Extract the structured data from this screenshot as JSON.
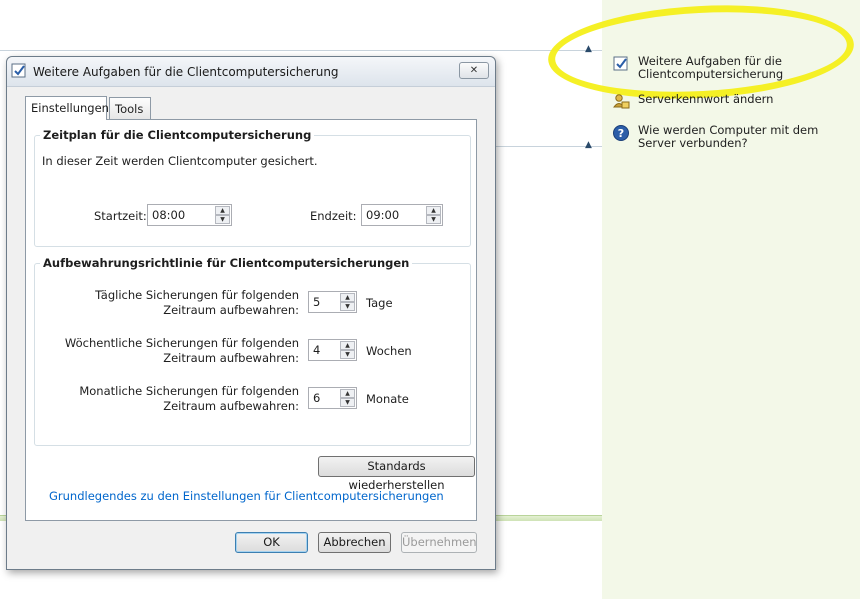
{
  "background": {
    "tasks": [
      {
        "icon": "checkbox-icon",
        "label": "Weitere Aufgaben für die Clientcomputersicherung"
      },
      {
        "icon": "users-key-icon",
        "label": "Serverkennwort ändern"
      },
      {
        "icon": "help-icon",
        "label": "Wie werden Computer mit dem Server verbunden?"
      }
    ],
    "highlight_color": "#f4ef1a"
  },
  "dialog": {
    "title": "Weitere Aufgaben für die Clientcomputersicherung",
    "close_label": "✕",
    "tabs": [
      {
        "label": "Einstellungen",
        "active": true
      },
      {
        "label": "Tools",
        "active": false
      }
    ],
    "schedule": {
      "title": "Zeitplan für die Clientcomputersicherung",
      "description": "In dieser Zeit werden Clientcomputer gesichert.",
      "start_label": "Startzeit:",
      "start_value": "08:00",
      "end_label": "Endzeit:",
      "end_value": "09:00"
    },
    "retention": {
      "title": "Aufbewahrungsrichtlinie für Clientcomputersicherungen",
      "rows": [
        {
          "label": "Tägliche Sicherungen für folgenden Zeitraum aufbewahren:",
          "value": "5",
          "unit": "Tage"
        },
        {
          "label": "Wöchentliche Sicherungen für folgenden Zeitraum aufbewahren:",
          "value": "4",
          "unit": "Wochen"
        },
        {
          "label": "Monatliche Sicherungen für folgenden Zeitraum aufbewahren:",
          "value": "6",
          "unit": "Monate"
        }
      ]
    },
    "restore_button": "Standards wiederherstellen",
    "help_link": "Grundlegendes zu den Einstellungen für Clientcomputersicherungen",
    "buttons": {
      "ok": "OK",
      "cancel": "Abbrechen",
      "apply": "Übernehmen"
    }
  }
}
